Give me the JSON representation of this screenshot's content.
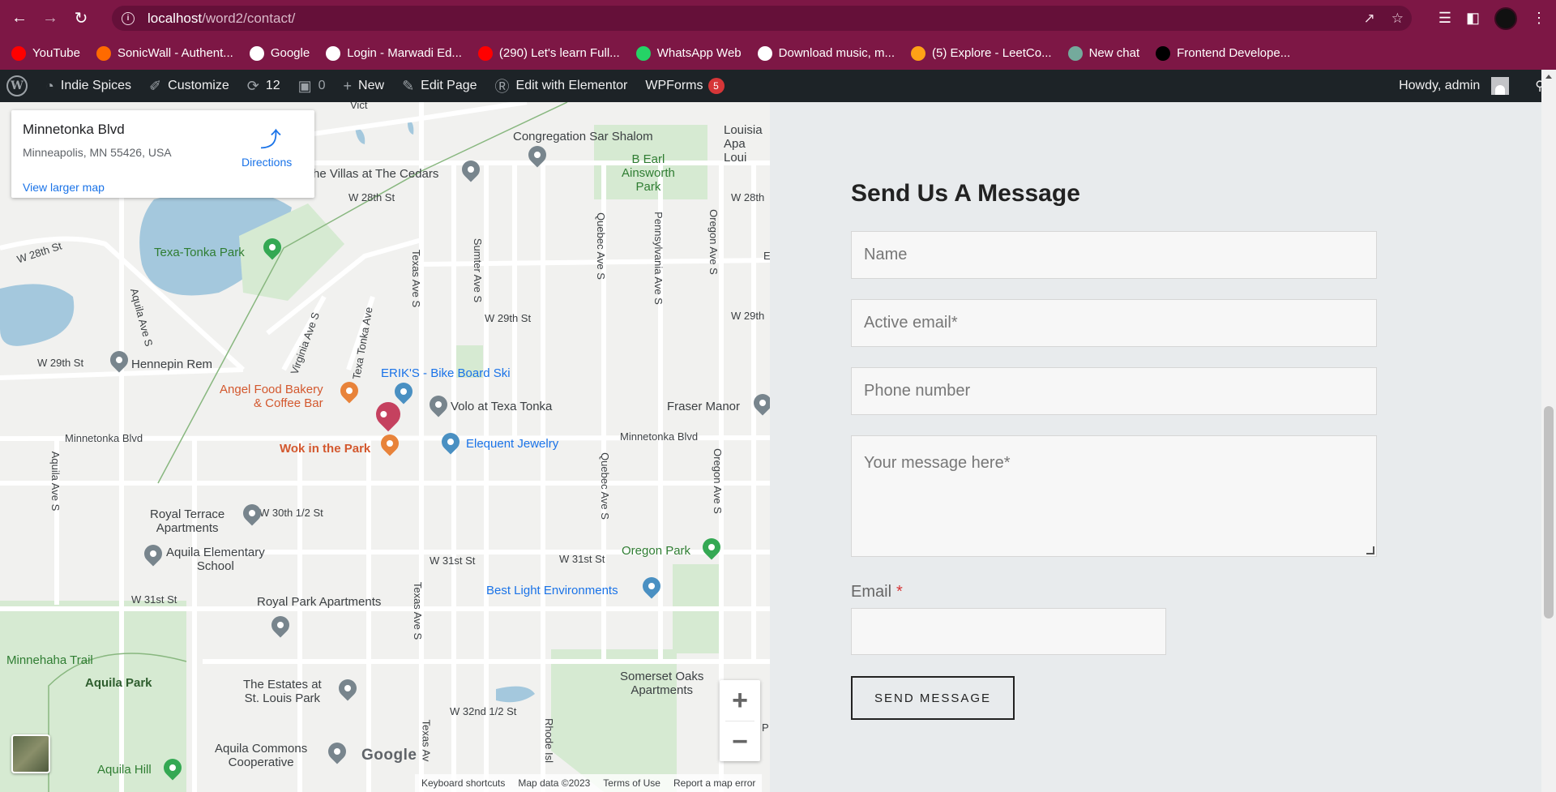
{
  "browser": {
    "url_host": "localhost",
    "url_path": "/word2/contact/"
  },
  "bookmarks": [
    {
      "label": "YouTube",
      "icon": "youtube-icon",
      "color": "#ff0000"
    },
    {
      "label": "SonicWall - Authent...",
      "icon": "sonicwall-icon",
      "color": "#ff6a00"
    },
    {
      "label": "Google",
      "icon": "google-icon",
      "color": "#ffffff"
    },
    {
      "label": "Login - Marwadi Ed...",
      "icon": "globe-icon",
      "color": "#ffffff"
    },
    {
      "label": "(290) Let's learn Full...",
      "icon": "youtube-icon",
      "color": "#ff0000"
    },
    {
      "label": "WhatsApp Web",
      "icon": "whatsapp-icon",
      "color": "#25d366"
    },
    {
      "label": "Download music, m...",
      "icon": "download-icon",
      "color": "#ffffff"
    },
    {
      "label": "(5) Explore - LeetCo...",
      "icon": "leetcode-icon",
      "color": "#ffa116"
    },
    {
      "label": "New chat",
      "icon": "chatgpt-icon",
      "color": "#74aa9c"
    },
    {
      "label": "Frontend Develope...",
      "icon": "frontend-icon",
      "color": "#000000"
    }
  ],
  "adminbar": {
    "site": "Indie Spices",
    "customize": "Customize",
    "updates": "12",
    "comments": "0",
    "new": "New",
    "edit_page": "Edit Page",
    "elementor": "Edit with Elementor",
    "wpforms": "WPForms",
    "wpforms_badge": "5",
    "howdy": "Howdy, admin"
  },
  "map": {
    "card": {
      "title": "Minnetonka Blvd",
      "address": "Minneapolis, MN 55426, USA",
      "directions": "Directions",
      "larger": "View larger map"
    },
    "places": {
      "congregation": "Congregation Sar Shalom",
      "louisiana": "Louisia\nApa\nLoui",
      "beral": "B Earl\nAinsworth\nPark",
      "villas": "he Villas at The Cedars",
      "texa_tonka": "Texa-Tonka Park",
      "hennepin": "Hennepin Rem",
      "eriks": "ERIK'S - Bike Board Ski",
      "angel": "Angel Food Bakery\n& Coffee Bar",
      "volo": "Volo at Texa Tonka",
      "fraser": "Fraser Manor",
      "wok": "Wok in the Park",
      "jewelry": "Elequent Jewelry",
      "royal_terrace": "Royal Terrace\nApartments",
      "aquila_elem": "Aquila Elementary\nSchool",
      "oregon_park": "Oregon Park",
      "best_light": "Best Light Environments",
      "royal_park": "Royal Park Apartments",
      "minnehaha": "Minnehaha Trail",
      "aquila_park": "Aquila Park",
      "estates": "The Estates at\nSt. Louis Park",
      "somerset": "Somerset Oaks\nApartments",
      "commons": "Aquila Commons\nCooperative",
      "aquila_hill": "Aquila Hill"
    },
    "streets": {
      "w28_a": "W 28th St",
      "w28_b": "W 28th St",
      "w28_c": "W 28th",
      "w29_a": "W 29th St",
      "w29_b": "W 29th St",
      "w29_c": "W 29th",
      "mtka_a": "Minnetonka Blvd",
      "mtka_b": "Minnetonka Blvd",
      "w30": "W 30th 1/2 St",
      "w31_a": "W 31st St",
      "w31_b": "W 31st St",
      "w31_c": "W 31st St",
      "w32": "W 32nd 1/2 St",
      "texas1": "Texas Ave S",
      "texas2": "Texas Ave S",
      "texas3": "Texas Av",
      "sumter": "Sumter Ave S",
      "quebec1": "Quebec Ave S",
      "quebec2": "Quebec Ave S",
      "penn": "Pennsylvania Ave S",
      "oregon1": "Oregon Ave S",
      "oregon2": "Oregon Ave S",
      "aquila1": "Aquila Ave S",
      "aquila2": "Aquila Ave S",
      "virginia": "Virginia Ave S",
      "texatonka": "Texa Tonka Ave",
      "rhode": "Rhode Isl",
      "vic": "Vict",
      "e": "E",
      "p": "P"
    },
    "google": "Google",
    "attrib": [
      "Keyboard shortcuts",
      "Map data ©2023",
      "Terms of Use",
      "Report a map error"
    ]
  },
  "form": {
    "title": "Send Us A Message",
    "name_placeholder": "Name",
    "email_placeholder": "Active email*",
    "phone_placeholder": "Phone number",
    "message_placeholder": "Your message here*",
    "email_label": "Email",
    "required_mark": "*",
    "submit": "SEND MESSAGE"
  }
}
